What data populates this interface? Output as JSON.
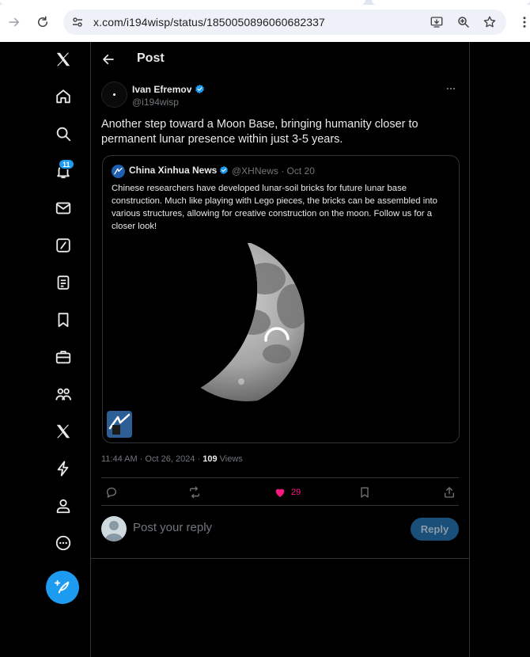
{
  "browser": {
    "url": "x.com/i194wisp/status/1850050896060682337"
  },
  "sidebar": {
    "notifications_badge": "11"
  },
  "header": {
    "title": "Post"
  },
  "post": {
    "author_name": "Ivan Efremov",
    "author_handle": "@i194wisp",
    "text": "Another step toward a Moon Base, bringing humanity closer to permanent lunar presence within just 3-5 years.",
    "timestamp": "11:44 AM · Oct 26, 2024 · ",
    "views_count": "109",
    "views_label": " Views",
    "like_count": "29"
  },
  "quote": {
    "author_name": "China Xinhua News",
    "author_handle": "@XHNews · Oct 20",
    "text": "Chinese researchers have developed lunar-soil bricks for future lunar base construction. Much like playing with Lego pieces, the bricks can be assembled into various structures, allowing for creative construction on the moon. Follow us for a closer look!"
  },
  "reply": {
    "placeholder": "Post your reply",
    "button_label": "Reply"
  },
  "colors": {
    "accent": "#1d9bf0",
    "like": "#f91880",
    "background": "#000000"
  }
}
